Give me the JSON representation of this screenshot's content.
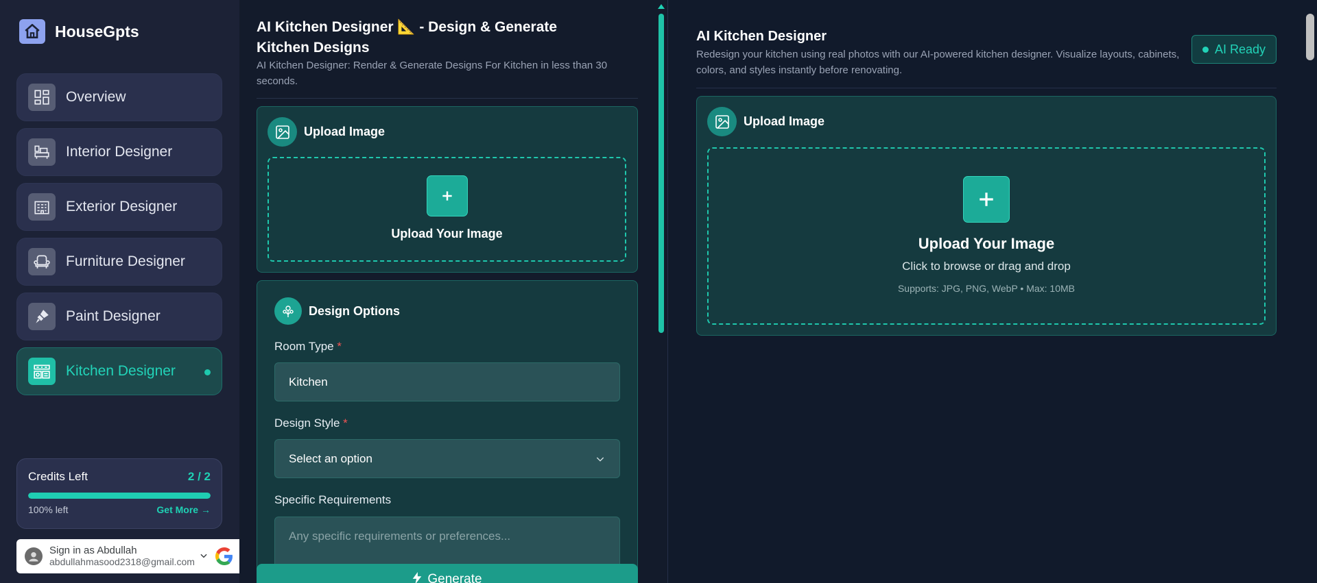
{
  "brand": {
    "name": "HouseGpts"
  },
  "sidebar": {
    "items": [
      {
        "label": "Overview",
        "icon": "dashboard-icon"
      },
      {
        "label": "Interior Designer",
        "icon": "interior-icon"
      },
      {
        "label": "Exterior Designer",
        "icon": "building-icon"
      },
      {
        "label": "Furniture Designer",
        "icon": "armchair-icon"
      },
      {
        "label": "Paint Designer",
        "icon": "paint-brush-icon"
      },
      {
        "label": "Kitchen Designer",
        "icon": "kitchen-icon",
        "active": true
      }
    ]
  },
  "credits": {
    "title": "Credits Left",
    "count": "2 / 2",
    "fill_fraction": 1.0,
    "left_label": "100% left",
    "more_label": "Get More →"
  },
  "signin": {
    "name": "Sign in as Abdullah",
    "email": "abdullahmasood2318@gmail.com"
  },
  "middle": {
    "title": "AI Kitchen Designer 📐 - Design & Generate Kitchen Designs",
    "subtitle": "AI Kitchen Designer: Render & Generate Designs For Kitchen in less than 30 seconds.",
    "upload": {
      "heading": "Upload Image",
      "dropzone_label": "Upload Your Image"
    },
    "options": {
      "heading": "Design Options",
      "room_type_label": "Room Type",
      "room_type_value": "Kitchen",
      "design_style_label": "Design Style",
      "design_style_value": "Select an option",
      "requirements_label": "Specific Requirements",
      "requirements_placeholder": "Any specific requirements or preferences...",
      "required_mark": "*"
    },
    "generate_label": "Generate"
  },
  "right": {
    "title": "AI Kitchen Designer",
    "subtitle": "Redesign your kitchen using real photos with our AI-powered kitchen designer. Visualize layouts, cabinets, colors, and styles instantly before renovating.",
    "status": "AI Ready",
    "upload": {
      "heading": "Upload Image",
      "dropzone_title": "Upload Your Image",
      "dropzone_hint": "Click to browse or drag and drop",
      "dropzone_support": "Supports: JPG, PNG, WebP • Max: 10MB"
    }
  },
  "colors": {
    "accent": "#1fd1b4",
    "sidebar_bg": "#1c2236",
    "card_bg": "#153a3f",
    "page_bg": "#111a2b"
  }
}
